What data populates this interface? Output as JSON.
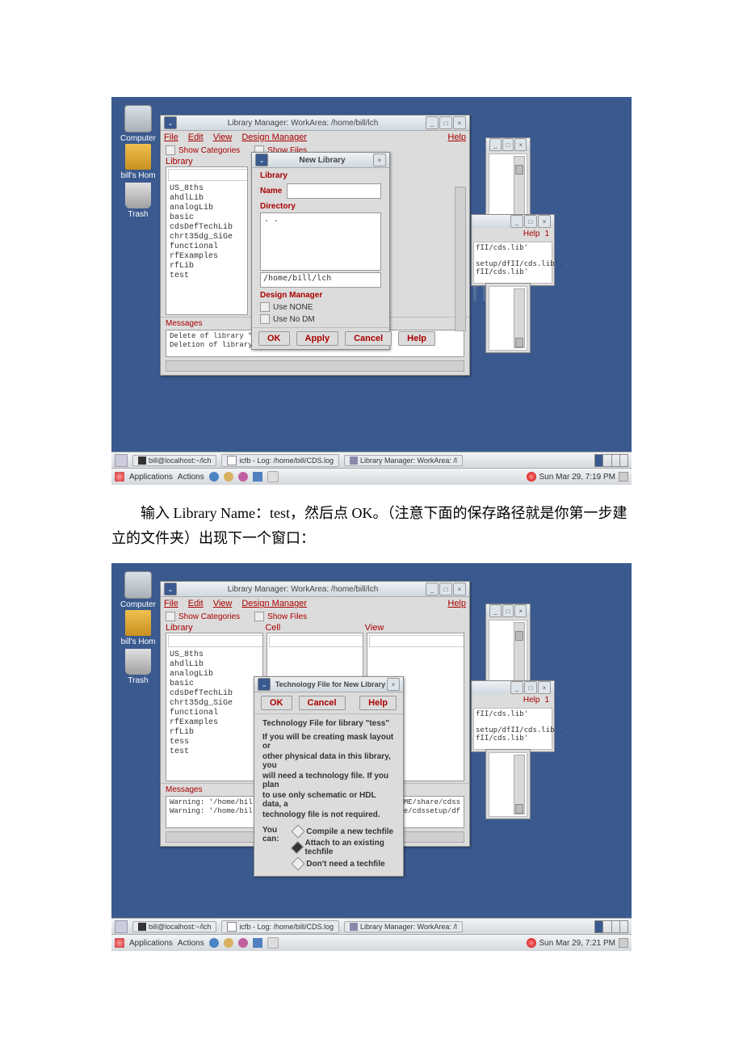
{
  "desktop": {
    "icons": {
      "computer": "Computer",
      "home": "bill's Hom",
      "trash": "Trash"
    }
  },
  "libmgr": {
    "title": "Library Manager: WorkArea: /home/bill/lch",
    "menu": {
      "file": "File",
      "edit": "Edit",
      "view": "View",
      "design_manager": "Design Manager",
      "help": "Help"
    },
    "show_categories": "Show Categories",
    "show_files": "Show Files",
    "col_library": "Library",
    "col_cell": "Cell",
    "col_view": "View",
    "libs": [
      "US_8ths",
      "ahdlLib",
      "analogLib",
      "basic",
      "cdsDefTechLib",
      "chrt35dg_SiGe",
      "functional",
      "rfExamples",
      "rfLib",
      "test"
    ],
    "libs2": [
      "US_8ths",
      "ahdlLib",
      "analogLib",
      "basic",
      "cdsDefTechLib",
      "chrt35dg_SiGe",
      "functional",
      "rfExamples",
      "rfLib",
      "tess",
      "test"
    ],
    "messages_label": "Messages",
    "msg1a": "Delete of library \"tess",
    "msg1b": "Deletion of library done",
    "msg2a": "Warning: '/home/bill/PDK/",
    "msg2b": "Warning: '/home/bill/PDK/wo...",
    "msg2c": "HOME/share/cdss",
    "msg2d": "are/cdssetup/df"
  },
  "newlib": {
    "title": "New Library",
    "library_label": "Library",
    "name_label": "Name",
    "directory_label": "Directory",
    "dir_item": ". .",
    "path": "/home/bill/lch",
    "dm_label": "Design Manager",
    "use_none": "Use  NONE",
    "use_nodm": "Use No DM",
    "ok": "OK",
    "apply": "Apply",
    "cancel": "Cancel",
    "help": "Help"
  },
  "tech": {
    "title": "Technology File for New Library",
    "ok": "OK",
    "cancel": "Cancel",
    "help": "Help",
    "heading": "Technology File for library \"tess\"",
    "l1": "If you will be creating mask layout or",
    "l2": "other physical data in this library, you",
    "l3": "will need a technology file. If you plan",
    "l4": "to use only schematic or HDL data, a",
    "l5": "technology file is not required.",
    "youcan": "You can:",
    "r1": "Compile a new techfile",
    "r2": "Attach to an existing techfile",
    "r3": "Don't need a techfile"
  },
  "bg": {
    "help": "Help",
    "one": "1",
    "t1": "fII/cds.lib'",
    "t2": "setup/dfII/cds.lib'.",
    "t3": "fII/cds.lib'"
  },
  "taskbar": {
    "term": "bill@localhost:~/lch",
    "log": "icfb - Log: /home/bill/CDS.log",
    "libmgr": "Library Manager: WorkArea: /l"
  },
  "panel": {
    "apps": "Applications",
    "actions": "Actions",
    "time1": "Sun Mar 29,  7:19 PM",
    "time2": "Sun Mar 29,  7:21 PM"
  },
  "cn_text": "　　输入 Library Name：test，然后点 OK。（注意下面的保存路径就是你第一步建立的文件夹）出现下一个窗口："
}
